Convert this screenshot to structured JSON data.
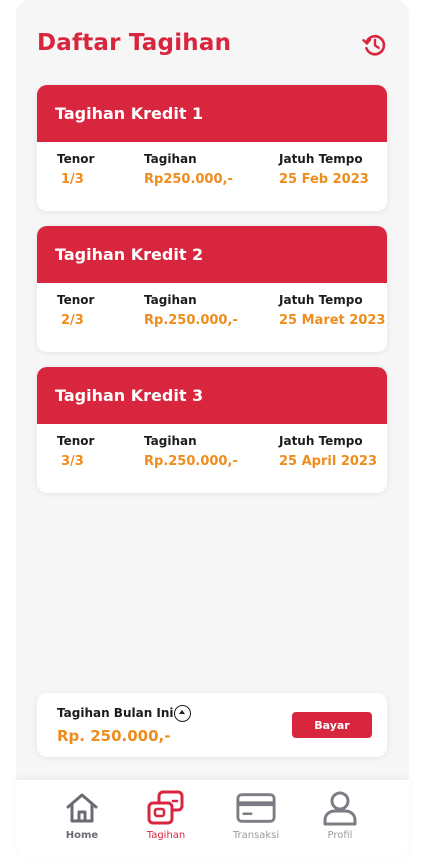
{
  "header": {
    "title": "Daftar Tagihan",
    "history_icon": "history-icon"
  },
  "labels": {
    "tenor": "Tenor",
    "tagihan": "Tagihan",
    "jatuh_tempo": "Jatuh Tempo"
  },
  "bills": [
    {
      "title": "Tagihan Kredit 1",
      "tenor": "1/3",
      "amount": "Rp250.000,-",
      "due": "25 Feb 2023"
    },
    {
      "title": "Tagihan Kredit 2",
      "tenor": "2/3",
      "amount": "Rp.250.000,-",
      "due": "25 Maret 2023"
    },
    {
      "title": "Tagihan Kredit 3",
      "tenor": "3/3",
      "amount": "Rp.250.000,-",
      "due": "25 April 2023"
    }
  ],
  "summary": {
    "label": "Tagihan Bulan Ini",
    "amount": "Rp. 250.000,-",
    "pay_label": "Bayar"
  },
  "nav": [
    {
      "label": "Home",
      "icon": "home-icon"
    },
    {
      "label": "Tagihan",
      "icon": "bill-icon",
      "active": true
    },
    {
      "label": "Transaksi",
      "icon": "card-icon"
    },
    {
      "label": "Profil",
      "icon": "user-icon"
    }
  ],
  "colors": {
    "primary": "#d7263d",
    "amount": "#ef8c1e",
    "nav_inactive": "#6b6b73"
  }
}
